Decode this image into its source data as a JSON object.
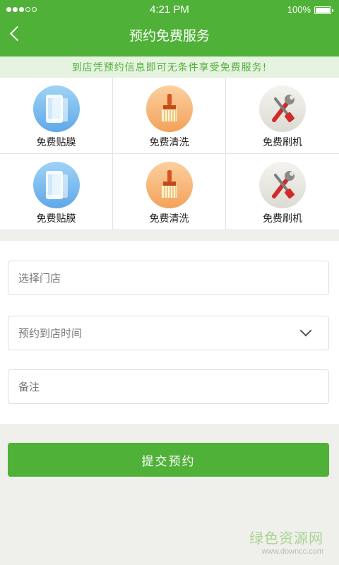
{
  "status_bar": {
    "time": "4:21 PM",
    "battery_percent": "100%",
    "signal_dots": [
      "full",
      "full",
      "full",
      "empty",
      "empty"
    ]
  },
  "header": {
    "title": "预约免费服务",
    "back_icon": "chevron-left-icon"
  },
  "notice": "到店凭预约信息即可无条件享受免费服务!",
  "services": [
    {
      "label": "免费贴膜",
      "icon": "phone-film-icon"
    },
    {
      "label": "免费清洗",
      "icon": "brush-icon"
    },
    {
      "label": "免费刷机",
      "icon": "tools-icon"
    },
    {
      "label": "免费贴膜",
      "icon": "phone-film-icon"
    },
    {
      "label": "免费清洗",
      "icon": "brush-icon"
    },
    {
      "label": "免费刷机",
      "icon": "tools-icon"
    }
  ],
  "form": {
    "store_placeholder": "选择门店",
    "time_placeholder": "预约到店时间",
    "note_placeholder": "备注"
  },
  "submit_label": "提交预约",
  "watermark": {
    "title": "绿色资源网",
    "url": "www.downcc.com"
  },
  "colors": {
    "brand_green": "#4fb137",
    "notice_bg": "#e7f3e1",
    "page_bg": "#efefeb"
  }
}
